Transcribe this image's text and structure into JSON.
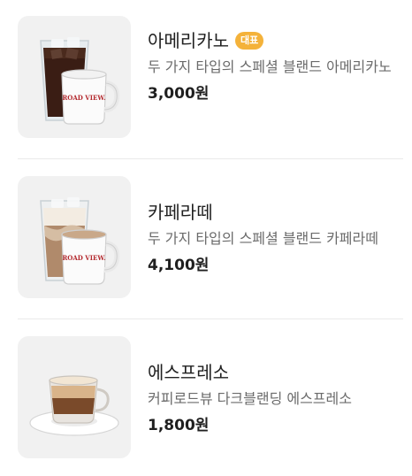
{
  "menu": {
    "items": [
      {
        "name": "아메리카노",
        "badge": "대표",
        "description": "두 가지 타입의 스페셜 블랜드 아메리카노",
        "price": "3,000원",
        "image": "iced-americano-and-mug-photo",
        "mug_text": "ROAD VIEW."
      },
      {
        "name": "카페라떼",
        "description": "두 가지 타입의 스페셜 블랜드 카페라떼",
        "price": "4,100원",
        "image": "iced-latte-and-mug-photo",
        "mug_text": "ROAD VIEW."
      },
      {
        "name": "에스프레소",
        "description": "커피로드뷰 다크블랜딩 에스프레소",
        "price": "1,800원",
        "image": "espresso-cup-photo"
      }
    ]
  },
  "colors": {
    "badge_bg": "#f4b23a",
    "thumb_bg": "#f1f1f1",
    "divider": "#eaeaea",
    "description_text": "#6b6b6b",
    "primary_text": "#1f1f1f"
  }
}
